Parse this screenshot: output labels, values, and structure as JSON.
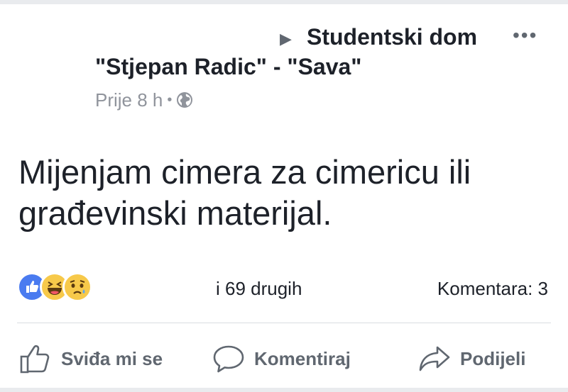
{
  "post": {
    "group_line1": "Studentski dom",
    "group_line2": "\"Stjepan Radic\" - \"Sava\"",
    "time": "Prije 8 h",
    "separator": "•",
    "audience_icon": "globe-icon",
    "more_icon": "more-horizontal-icon",
    "arrow_icon": "triangle-right-icon",
    "text": "Mijenjam cimera za cimericu ili građevinski materijal."
  },
  "reactions": {
    "icons": [
      "like-reaction-icon",
      "haha-reaction-icon",
      "sad-reaction-icon"
    ],
    "others": "i 69 drugih",
    "comments": "Komentara: 3"
  },
  "actions": {
    "like_label": "Sviđa mi se",
    "comment_label": "Komentiraj",
    "share_label": "Podijeli"
  },
  "colors": {
    "text": "#1d2129",
    "secondary": "#606770",
    "meta": "#90949c",
    "like_blue": "#4a7bf0",
    "emoji_yellow": "#f7c94a",
    "background": "#e9ebee",
    "card": "#ffffff"
  }
}
